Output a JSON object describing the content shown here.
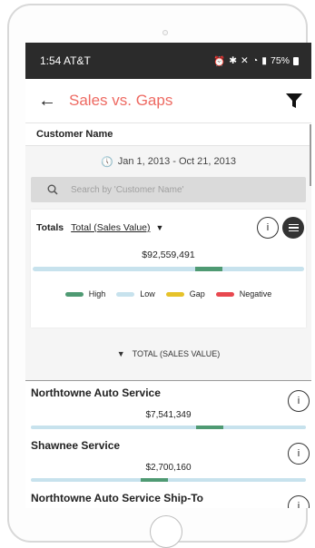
{
  "statusbar": {
    "time_carrier": "1:54 AT&T",
    "battery": "75%"
  },
  "appbar": {
    "title": "Sales vs. Gaps",
    "icons": [
      "back-arrow-icon",
      "filter-icon"
    ]
  },
  "filters": {
    "customer_name_label": "Customer Name",
    "date_range": "Jan 1, 2013 - Oct 21, 2013",
    "search_placeholder": "Search by 'Customer Name'"
  },
  "totals": {
    "label": "Totals",
    "measure": "Total (Sales Value)",
    "value": "$92,559,491",
    "bar": {
      "low_fraction": 1.0,
      "high_start": 0.6,
      "high_end": 0.7
    },
    "legend": [
      {
        "label": "High",
        "color": "#4f9a73"
      },
      {
        "label": "Low",
        "color": "#c7e2ed"
      },
      {
        "label": "Gap",
        "color": "#e6c22a"
      },
      {
        "label": "Negative",
        "color": "#e8484f"
      }
    ]
  },
  "group_header": "TOTAL (SALES VALUE)",
  "customers": [
    {
      "name": "Northtowne Auto Service",
      "value": "$7,541,349",
      "high_start": 0.6,
      "high_end": 0.7
    },
    {
      "name": "Shawnee Service",
      "value": "$2,700,160",
      "high_start": 0.4,
      "high_end": 0.5
    },
    {
      "name": "Northtowne Auto Service Ship-To",
      "value": "",
      "high_start": 0.0,
      "high_end": 0.0
    }
  ],
  "colors": {
    "accent": "#ee6a62",
    "statusbar": "#2b2b2b",
    "high": "#4f9a73",
    "low": "#c7e2ed"
  }
}
